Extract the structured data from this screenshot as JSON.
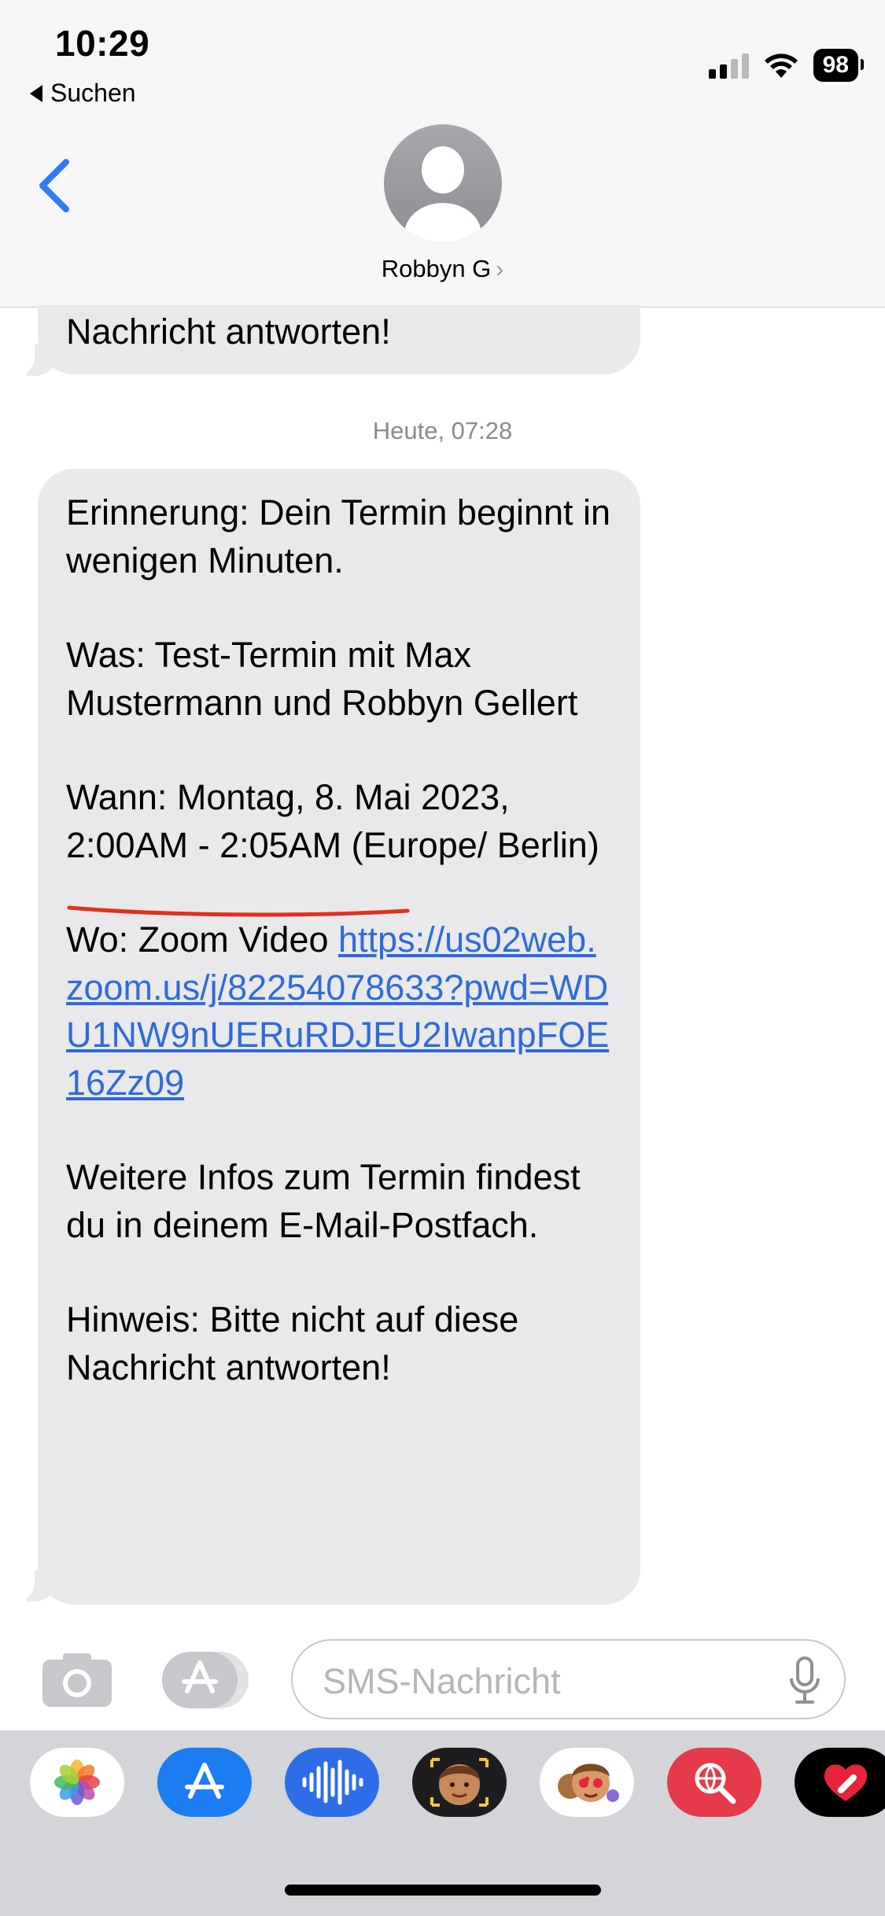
{
  "status_bar": {
    "time": "10:29",
    "back_app_label": "Suchen",
    "battery": "98"
  },
  "header": {
    "contact_name": "Robbyn G",
    "chevron": "›",
    "back_icon": "chevron-left-icon"
  },
  "messages": {
    "previous_tail": "Nachricht antworten!",
    "timestamp": "Heute, 07:28",
    "main": {
      "p1": "Erinnerung: Dein Termin beginnt in wenigen Minuten.",
      "p2": "Was: Test-Termin mit Max Mustermann und Robbyn Gellert",
      "p3_prefix": "Wann: Montag, 8. Mai 2023, ",
      "p3_underlined": "2:00AM - 2:05AM ",
      "p3_suffix": "(Europe/ Berlin)",
      "p4_prefix": "Wo: Zoom Video ",
      "p4_link": "https://us02web.zoom.us/j/82254078633?pwd=WDU1NW9nUERuRDJEU2IwanpFOE16Zz09",
      "p5": "Weitere Infos zum Termin findest du in deinem E-Mail-Postfach.",
      "p6": "Hinweis: Bitte nicht auf diese Nachricht antworten!"
    }
  },
  "input": {
    "placeholder": "SMS-Nachricht"
  },
  "app_drawer": [
    {
      "name": "photos-icon",
      "bg": "#ffffff"
    },
    {
      "name": "app-store-icon",
      "bg": "#1c7cf2"
    },
    {
      "name": "audio-message-icon",
      "bg": "#2d6ee8"
    },
    {
      "name": "memoji-icon",
      "bg": "#1d1d1f"
    },
    {
      "name": "memoji-stickers-icon",
      "bg": "#ffffff"
    },
    {
      "name": "image-search-icon",
      "bg": "#e63a4b"
    },
    {
      "name": "digital-touch-icon",
      "bg": "#000000"
    }
  ],
  "colors": {
    "link": "#2f6bd8",
    "bubble": "#e9e9eb",
    "accent": "#2f7cf6",
    "underline_mark": "#e0301e"
  }
}
